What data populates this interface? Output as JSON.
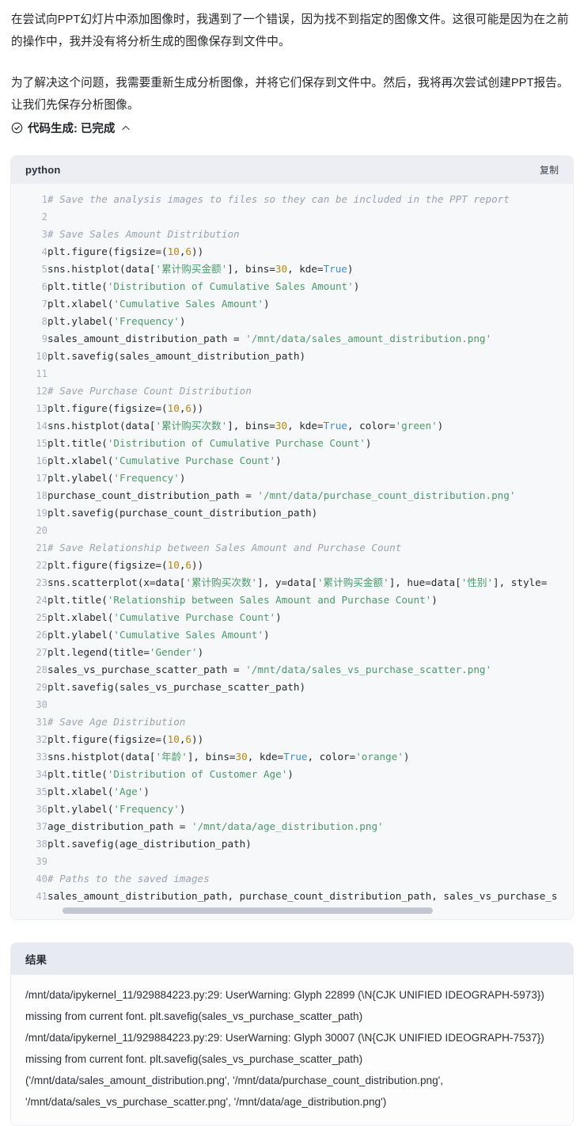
{
  "narrative": {
    "paragraph_1": "在尝试向PPT幻灯片中添加图像时，我遇到了一个错误，因为找不到指定的图像文件。这很可能是因为在之前的操作中，我并没有将分析生成的图像保存到文件中。",
    "paragraph_2": "为了解决这个问题，我需要重新生成分析图像，并将它们保存到文件中。然后，我将再次尝试创建PPT报告。让我们先保存分析图像。"
  },
  "status": {
    "icon": "check-circle-icon",
    "label": "代码生成: 已完成",
    "chevron": "chevron-up-icon"
  },
  "code_block": {
    "language": "python",
    "copy_label": "复制",
    "lines": [
      {
        "n": "1",
        "tokens": [
          {
            "t": "com",
            "v": "# Save the analysis images to files so they can be included in the PPT report"
          }
        ]
      },
      {
        "n": "2",
        "tokens": []
      },
      {
        "n": "3",
        "tokens": [
          {
            "t": "com",
            "v": "# Save Sales Amount Distribution"
          }
        ]
      },
      {
        "n": "4",
        "tokens": [
          {
            "t": "pln",
            "v": "plt.figure(figsize=("
          },
          {
            "t": "num",
            "v": "10"
          },
          {
            "t": "pln",
            "v": ","
          },
          {
            "t": "num",
            "v": "6"
          },
          {
            "t": "pln",
            "v": "))"
          }
        ]
      },
      {
        "n": "5",
        "tokens": [
          {
            "t": "pln",
            "v": "sns.histplot(data["
          },
          {
            "t": "str",
            "v": "'累计购买金额'"
          },
          {
            "t": "pln",
            "v": "], bins="
          },
          {
            "t": "num",
            "v": "30"
          },
          {
            "t": "pln",
            "v": ", kde="
          },
          {
            "t": "kw",
            "v": "True"
          },
          {
            "t": "pln",
            "v": ")"
          }
        ]
      },
      {
        "n": "6",
        "tokens": [
          {
            "t": "pln",
            "v": "plt.title("
          },
          {
            "t": "str",
            "v": "'Distribution of Cumulative Sales Amount'"
          },
          {
            "t": "pln",
            "v": ")"
          }
        ]
      },
      {
        "n": "7",
        "tokens": [
          {
            "t": "pln",
            "v": "plt.xlabel("
          },
          {
            "t": "str",
            "v": "'Cumulative Sales Amount'"
          },
          {
            "t": "pln",
            "v": ")"
          }
        ]
      },
      {
        "n": "8",
        "tokens": [
          {
            "t": "pln",
            "v": "plt.ylabel("
          },
          {
            "t": "str",
            "v": "'Frequency'"
          },
          {
            "t": "pln",
            "v": ")"
          }
        ]
      },
      {
        "n": "9",
        "tokens": [
          {
            "t": "pln",
            "v": "sales_amount_distribution_path = "
          },
          {
            "t": "str",
            "v": "'/mnt/data/sales_amount_distribution.png'"
          }
        ]
      },
      {
        "n": "10",
        "tokens": [
          {
            "t": "pln",
            "v": "plt.savefig(sales_amount_distribution_path)"
          }
        ]
      },
      {
        "n": "11",
        "tokens": []
      },
      {
        "n": "12",
        "tokens": [
          {
            "t": "com",
            "v": "# Save Purchase Count Distribution"
          }
        ]
      },
      {
        "n": "13",
        "tokens": [
          {
            "t": "pln",
            "v": "plt.figure(figsize=("
          },
          {
            "t": "num",
            "v": "10"
          },
          {
            "t": "pln",
            "v": ","
          },
          {
            "t": "num",
            "v": "6"
          },
          {
            "t": "pln",
            "v": "))"
          }
        ]
      },
      {
        "n": "14",
        "tokens": [
          {
            "t": "pln",
            "v": "sns.histplot(data["
          },
          {
            "t": "str",
            "v": "'累计购买次数'"
          },
          {
            "t": "pln",
            "v": "], bins="
          },
          {
            "t": "num",
            "v": "30"
          },
          {
            "t": "pln",
            "v": ", kde="
          },
          {
            "t": "kw",
            "v": "True"
          },
          {
            "t": "pln",
            "v": ", color="
          },
          {
            "t": "str",
            "v": "'green'"
          },
          {
            "t": "pln",
            "v": ")"
          }
        ]
      },
      {
        "n": "15",
        "tokens": [
          {
            "t": "pln",
            "v": "plt.title("
          },
          {
            "t": "str",
            "v": "'Distribution of Cumulative Purchase Count'"
          },
          {
            "t": "pln",
            "v": ")"
          }
        ]
      },
      {
        "n": "16",
        "tokens": [
          {
            "t": "pln",
            "v": "plt.xlabel("
          },
          {
            "t": "str",
            "v": "'Cumulative Purchase Count'"
          },
          {
            "t": "pln",
            "v": ")"
          }
        ]
      },
      {
        "n": "17",
        "tokens": [
          {
            "t": "pln",
            "v": "plt.ylabel("
          },
          {
            "t": "str",
            "v": "'Frequency'"
          },
          {
            "t": "pln",
            "v": ")"
          }
        ]
      },
      {
        "n": "18",
        "tokens": [
          {
            "t": "pln",
            "v": "purchase_count_distribution_path = "
          },
          {
            "t": "str",
            "v": "'/mnt/data/purchase_count_distribution.png'"
          }
        ]
      },
      {
        "n": "19",
        "tokens": [
          {
            "t": "pln",
            "v": "plt.savefig(purchase_count_distribution_path)"
          }
        ]
      },
      {
        "n": "20",
        "tokens": []
      },
      {
        "n": "21",
        "tokens": [
          {
            "t": "com",
            "v": "# Save Relationship between Sales Amount and Purchase Count"
          }
        ]
      },
      {
        "n": "22",
        "tokens": [
          {
            "t": "pln",
            "v": "plt.figure(figsize=("
          },
          {
            "t": "num",
            "v": "10"
          },
          {
            "t": "pln",
            "v": ","
          },
          {
            "t": "num",
            "v": "6"
          },
          {
            "t": "pln",
            "v": "))"
          }
        ]
      },
      {
        "n": "23",
        "tokens": [
          {
            "t": "pln",
            "v": "sns.scatterplot(x=data["
          },
          {
            "t": "str",
            "v": "'累计购买次数'"
          },
          {
            "t": "pln",
            "v": "], y=data["
          },
          {
            "t": "str",
            "v": "'累计购买金额'"
          },
          {
            "t": "pln",
            "v": "], hue=data["
          },
          {
            "t": "str",
            "v": "'性别'"
          },
          {
            "t": "pln",
            "v": "], style="
          }
        ]
      },
      {
        "n": "24",
        "tokens": [
          {
            "t": "pln",
            "v": "plt.title("
          },
          {
            "t": "str",
            "v": "'Relationship between Sales Amount and Purchase Count'"
          },
          {
            "t": "pln",
            "v": ")"
          }
        ]
      },
      {
        "n": "25",
        "tokens": [
          {
            "t": "pln",
            "v": "plt.xlabel("
          },
          {
            "t": "str",
            "v": "'Cumulative Purchase Count'"
          },
          {
            "t": "pln",
            "v": ")"
          }
        ]
      },
      {
        "n": "26",
        "tokens": [
          {
            "t": "pln",
            "v": "plt.ylabel("
          },
          {
            "t": "str",
            "v": "'Cumulative Sales Amount'"
          },
          {
            "t": "pln",
            "v": ")"
          }
        ]
      },
      {
        "n": "27",
        "tokens": [
          {
            "t": "pln",
            "v": "plt.legend(title="
          },
          {
            "t": "str",
            "v": "'Gender'"
          },
          {
            "t": "pln",
            "v": ")"
          }
        ]
      },
      {
        "n": "28",
        "tokens": [
          {
            "t": "pln",
            "v": "sales_vs_purchase_scatter_path = "
          },
          {
            "t": "str",
            "v": "'/mnt/data/sales_vs_purchase_scatter.png'"
          }
        ]
      },
      {
        "n": "29",
        "tokens": [
          {
            "t": "pln",
            "v": "plt.savefig(sales_vs_purchase_scatter_path)"
          }
        ]
      },
      {
        "n": "30",
        "tokens": []
      },
      {
        "n": "31",
        "tokens": [
          {
            "t": "com",
            "v": "# Save Age Distribution"
          }
        ]
      },
      {
        "n": "32",
        "tokens": [
          {
            "t": "pln",
            "v": "plt.figure(figsize=("
          },
          {
            "t": "num",
            "v": "10"
          },
          {
            "t": "pln",
            "v": ","
          },
          {
            "t": "num",
            "v": "6"
          },
          {
            "t": "pln",
            "v": "))"
          }
        ]
      },
      {
        "n": "33",
        "tokens": [
          {
            "t": "pln",
            "v": "sns.histplot(data["
          },
          {
            "t": "str",
            "v": "'年龄'"
          },
          {
            "t": "pln",
            "v": "], bins="
          },
          {
            "t": "num",
            "v": "30"
          },
          {
            "t": "pln",
            "v": ", kde="
          },
          {
            "t": "kw",
            "v": "True"
          },
          {
            "t": "pln",
            "v": ", color="
          },
          {
            "t": "str",
            "v": "'orange'"
          },
          {
            "t": "pln",
            "v": ")"
          }
        ]
      },
      {
        "n": "34",
        "tokens": [
          {
            "t": "pln",
            "v": "plt.title("
          },
          {
            "t": "str",
            "v": "'Distribution of Customer Age'"
          },
          {
            "t": "pln",
            "v": ")"
          }
        ]
      },
      {
        "n": "35",
        "tokens": [
          {
            "t": "pln",
            "v": "plt.xlabel("
          },
          {
            "t": "str",
            "v": "'Age'"
          },
          {
            "t": "pln",
            "v": ")"
          }
        ]
      },
      {
        "n": "36",
        "tokens": [
          {
            "t": "pln",
            "v": "plt.ylabel("
          },
          {
            "t": "str",
            "v": "'Frequency'"
          },
          {
            "t": "pln",
            "v": ")"
          }
        ]
      },
      {
        "n": "37",
        "tokens": [
          {
            "t": "pln",
            "v": "age_distribution_path = "
          },
          {
            "t": "str",
            "v": "'/mnt/data/age_distribution.png'"
          }
        ]
      },
      {
        "n": "38",
        "tokens": [
          {
            "t": "pln",
            "v": "plt.savefig(age_distribution_path)"
          }
        ]
      },
      {
        "n": "39",
        "tokens": []
      },
      {
        "n": "40",
        "tokens": [
          {
            "t": "com",
            "v": "# Paths to the saved images"
          }
        ]
      },
      {
        "n": "41",
        "tokens": [
          {
            "t": "pln",
            "v": "sales_amount_distribution_path, purchase_count_distribution_path, sales_vs_purchase_s"
          }
        ]
      }
    ]
  },
  "result_block": {
    "title": "结果",
    "lines": [
      "/mnt/data/ipykernel_11/929884223.py:29: UserWarning: Glyph 22899 (\\N{CJK UNIFIED IDEOGRAPH-5973}) missing from current font. plt.savefig(sales_vs_purchase_scatter_path)",
      "/mnt/data/ipykernel_11/929884223.py:29: UserWarning: Glyph 30007 (\\N{CJK UNIFIED IDEOGRAPH-7537}) missing from current font. plt.savefig(sales_vs_purchase_scatter_path)",
      "('/mnt/data/sales_amount_distribution.png', '/mnt/data/purchase_count_distribution.png', '/mnt/data/sales_vs_purchase_scatter.png', '/mnt/data/age_distribution.png')"
    ]
  },
  "colors": {
    "comment": "#9aa2ad",
    "string": "#4a9a69",
    "number": "#b8860b",
    "keyword": "#3b8fd4",
    "plain": "#24292f",
    "code_header_bg": "#eceef3",
    "code_body_bg": "#f7f8fa",
    "result_header_bg": "#e8eaf1"
  }
}
